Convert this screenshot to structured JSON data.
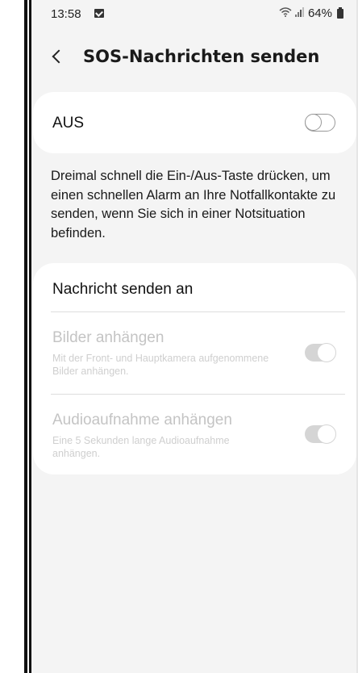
{
  "status_bar": {
    "time": "13:58",
    "message_icon": "message-icon",
    "wifi_icon": "wifi-icon",
    "signal_icon": "signal-icon",
    "battery": "64%",
    "battery_icon": "battery-icon"
  },
  "header": {
    "back_icon": "chevron-left-icon",
    "title": "SOS-Nachrichten senden"
  },
  "master_switch": {
    "label": "AUS",
    "state": "off"
  },
  "description": "Dreimal schnell die Ein-/Aus-Taste drücken, um einen schnellen Alarm an Ihre Notfallkontakte zu senden, wenn Sie sich in einer Notsituation befinden.",
  "options": {
    "section_title": "Nachricht senden an",
    "items": [
      {
        "title": "Bilder anhängen",
        "subtitle": "Mit der Front- und Hauptkamera aufgenommene Bilder anhängen.",
        "state": "on",
        "enabled": false
      },
      {
        "title": "Audioaufnahme anhängen",
        "subtitle": "Eine 5 Sekunden lange Audioaufnahme anhängen.",
        "state": "on",
        "enabled": false
      }
    ]
  },
  "colors": {
    "background": "#f4f4f4",
    "card": "#ffffff",
    "disabled_text": "#c4c4c4",
    "primary_text": "#111111"
  }
}
